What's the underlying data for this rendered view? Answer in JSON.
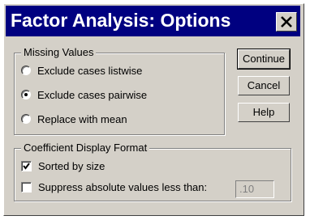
{
  "window": {
    "title": "Factor Analysis: Options",
    "close_glyph": "X"
  },
  "missing_values": {
    "legend": "Missing Values",
    "options": [
      {
        "label": "Exclude cases listwise",
        "selected": false
      },
      {
        "label": "Exclude cases pairwise",
        "selected": true
      },
      {
        "label": "Replace with mean",
        "selected": false
      }
    ]
  },
  "coefficient_format": {
    "legend": "Coefficient Display Format",
    "sorted_label": "Sorted by size",
    "sorted_checked": true,
    "suppress_label": "Suppress absolute values less than:",
    "suppress_checked": false,
    "suppress_value": ".10"
  },
  "buttons": {
    "continue": "Continue",
    "cancel": "Cancel",
    "help": "Help"
  }
}
